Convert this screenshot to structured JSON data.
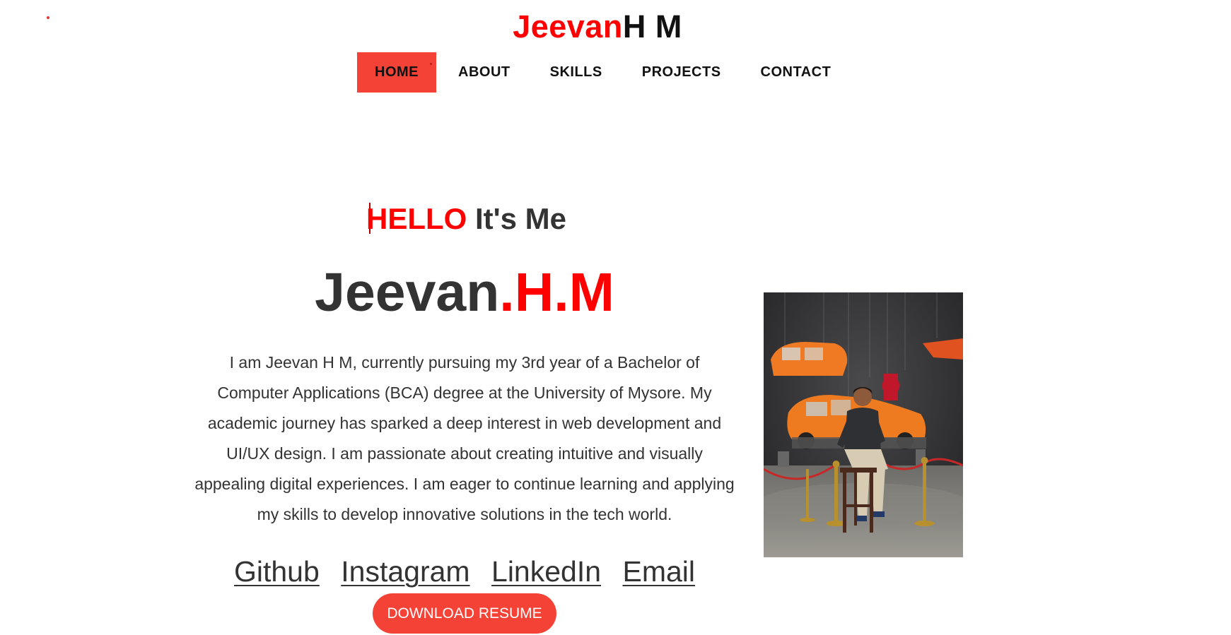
{
  "header": {
    "logo_first": "Jeevan",
    "logo_rest": "H M"
  },
  "nav": {
    "items": [
      {
        "label": "HOME",
        "active": true
      },
      {
        "label": "ABOUT",
        "active": false
      },
      {
        "label": "SKILLS",
        "active": false
      },
      {
        "label": "PROJECTS",
        "active": false
      },
      {
        "label": "CONTACT",
        "active": false
      }
    ]
  },
  "hero": {
    "greeting_highlight": "HELLO",
    "greeting_rest": " It's Me",
    "name_main": "Jeevan",
    "name_accent": ".H.M",
    "bio": "I am Jeevan H M, currently pursuing my 3rd year of a Bachelor of Computer Applications (BCA) degree at the University of Mysore. My academic journey has sparked a deep interest in web development and UI/UX design. I am passionate about creating intuitive and visually appealing digital experiences. I am eager to continue learning and applying my skills to develop innovative solutions in the tech world.",
    "links": [
      "Github",
      "Instagram",
      "LinkedIn",
      "Email"
    ],
    "resume_button": "DOWNLOAD RESUME"
  },
  "profile_photo": {
    "icon": "profile-photo"
  },
  "colors": {
    "accent": "#ff0000",
    "button": "#f44336",
    "text": "#333333"
  }
}
